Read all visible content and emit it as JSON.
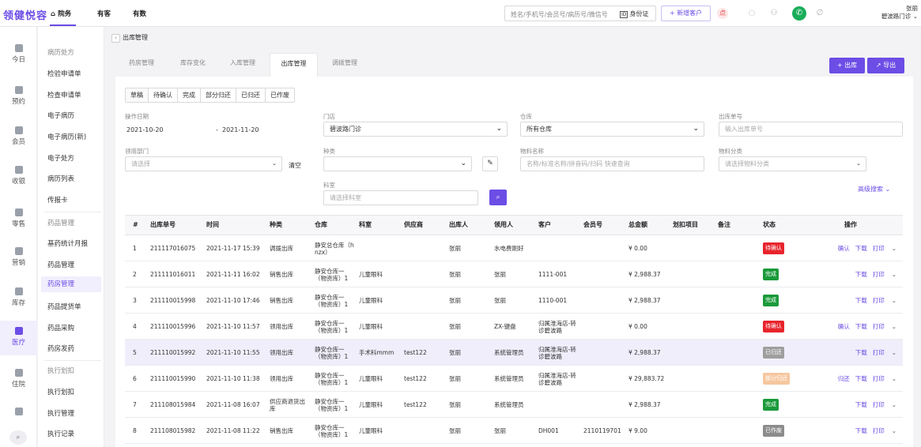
{
  "app": {
    "logo": "领健悦容",
    "nav": [
      "院务",
      "有客",
      "有数"
    ],
    "search_placeholder": "姓名/手机号/会员号/病历号/微信号",
    "idcard_icon": "id-card-icon",
    "idcard_label": "身份证",
    "new_customer": "+ 新增客户",
    "notice_badge": "点",
    "user_name": "张丽",
    "user_store": "碧波路门诊"
  },
  "left_nav": [
    "今日",
    "预约",
    "会员",
    "收银",
    "零售",
    "营销",
    "库存",
    "医疗",
    "住院",
    ""
  ],
  "sub_nav": {
    "groups": [
      {
        "title": "病历处方",
        "items": [
          "检验申请单",
          "检查申请单",
          "电子病历",
          "电子病历(新)",
          "电子处方",
          "病历列表",
          "传报卡"
        ]
      },
      {
        "title": "药品管理",
        "items": [
          "基药统计月报",
          "药品管理",
          "药房管理",
          "药品提货单",
          "药品采购",
          "药房发药"
        ]
      },
      {
        "title": "执行划扣",
        "items": [
          "执行划扣",
          "执行管理",
          "执行记录"
        ]
      }
    ],
    "active": "药房管理"
  },
  "breadcrumb": "出库管理",
  "tabs": [
    "药房管理",
    "库存变化",
    "入库管理",
    "出库管理",
    "调拨管理"
  ],
  "active_tab": "出库管理",
  "actions": {
    "out": "+ 出库",
    "export": "↗ 导出"
  },
  "status_filters": [
    "草稿",
    "待确认",
    "完成",
    "部分归还",
    "已归还",
    "已作废"
  ],
  "filters": {
    "op_date_label": "操作日期",
    "date_start": "2021-10-20",
    "date_sep": "-",
    "date_end": "2021-11-20",
    "store_label": "门店",
    "store_value": "碧波路门诊",
    "warehouse_label": "仓库",
    "warehouse_value": "所有仓库",
    "out_no_label": "出库单号",
    "out_no_placeholder": "输入出库单号",
    "dept_label": "领用部门",
    "dept_placeholder": "请选择",
    "clear": "清空",
    "kind_label": "种类",
    "kind_value": "",
    "material_label": "物料名称",
    "material_placeholder": "名称/标准名称/拼音码/扫码 快速查询",
    "category_label": "物料分类",
    "category_placeholder": "请选择物料分类",
    "room_label": "科室",
    "room_placeholder": "请选择科室",
    "advanced": "高级搜索"
  },
  "table": {
    "headers": [
      "#",
      "出库单号",
      "时间",
      "种类",
      "仓库",
      "科室",
      "供应商",
      "出库人",
      "领用人",
      "客户",
      "会员号",
      "总金额",
      "划扣项目",
      "备注",
      "状态",
      "操作"
    ],
    "rows": [
      {
        "no": "1",
        "id": "211117016075",
        "time": "2021-11-17 15:39",
        "kind": "调拨出库",
        "wh": "静安总仓库（hnzx）",
        "room": "",
        "supplier": "",
        "outer": "张丽",
        "taker": "水电费刚好",
        "customer": "",
        "member": "",
        "amount": "¥ 0.00",
        "deduct": "",
        "note": "",
        "status": "待确认",
        "status_color": "#e8242c",
        "ops": [
          "确认",
          "下载",
          "打印"
        ],
        "ops_dim": false
      },
      {
        "no": "2",
        "id": "211111016011",
        "time": "2021-11-11 16:02",
        "kind": "销售出库",
        "wh": "静安仓库一（物资库）1",
        "room": "儿童眼科",
        "supplier": "",
        "outer": "张丽",
        "taker": "张丽",
        "customer": "1111-001",
        "member": "",
        "amount": "¥ 2,988.37",
        "deduct": "",
        "note": "",
        "status": "完成",
        "status_color": "#1a9a3a",
        "ops": [
          "下载",
          "打印"
        ],
        "ops_dim": false
      },
      {
        "no": "3",
        "id": "211110015998",
        "time": "2021-11-10 17:46",
        "kind": "销售出库",
        "wh": "静安仓库一（物资库）1",
        "room": "儿童眼科",
        "supplier": "",
        "outer": "张丽",
        "taker": "张丽",
        "customer": "1110-001",
        "member": "",
        "amount": "¥ 2,988.37",
        "deduct": "",
        "note": "",
        "status": "完成",
        "status_color": "#1a9a3a",
        "ops": [
          "下载",
          "打印"
        ],
        "ops_dim": false
      },
      {
        "no": "4",
        "id": "211110015996",
        "time": "2021-11-10 11:57",
        "kind": "领用出库",
        "wh": "静安仓库一（物资库）1",
        "room": "儿童眼科",
        "supplier": "",
        "outer": "张丽",
        "taker": "ZX-键盘",
        "customer": "归属淮海店-转诊碧波路",
        "member": "",
        "amount": "¥ 0.00",
        "deduct": "",
        "note": "",
        "status": "待确认",
        "status_color": "#e8242c",
        "ops": [
          "确认",
          "下载",
          "打印"
        ],
        "ops_dim": false
      },
      {
        "no": "5",
        "id": "211110015992",
        "time": "2021-11-10 11:55",
        "kind": "领用出库",
        "wh": "静安仓库一（物资库）1",
        "room": "手术科mmm",
        "supplier": "test122",
        "outer": "张丽",
        "taker": "系统管理员",
        "customer": "归属淮海店-转诊碧波路",
        "member": "",
        "amount": "¥ 2,988.37",
        "deduct": "",
        "note": "",
        "status": "已归还",
        "status_color": "#9e9e9e",
        "ops": [
          "下载",
          "打印"
        ],
        "ops_dim": false
      },
      {
        "no": "6",
        "id": "211110015990",
        "time": "2021-11-10 11:38",
        "kind": "领用出库",
        "wh": "静安仓库一（物资库）1",
        "room": "儿童眼科",
        "supplier": "test122",
        "outer": "张丽",
        "taker": "系统管理员",
        "customer": "归属淮海店-转诊碧波路",
        "member": "",
        "amount": "¥ 29,883.72",
        "deduct": "",
        "note": "",
        "status": "部分归还",
        "status_color": "#f6c7a0",
        "ops": [
          "归还",
          "下载",
          "打印"
        ],
        "ops_dim": false
      },
      {
        "no": "7",
        "id": "211108015984",
        "time": "2021-11-08 16:07",
        "kind": "供应商退货出库",
        "wh": "静安仓库一（物资库）1",
        "room": "儿童眼科",
        "supplier": "test122",
        "outer": "张丽",
        "taker": "系统管理员",
        "customer": "",
        "member": "",
        "amount": "¥ 2,988.37",
        "deduct": "",
        "note": "",
        "status": "完成",
        "status_color": "#1a9a3a",
        "ops": [
          "下载",
          "打印"
        ],
        "ops_dim": false
      },
      {
        "no": "8",
        "id": "211108015982",
        "time": "2021-11-08 11:22",
        "kind": "销售出库",
        "wh": "静安仓库一（物资库）1",
        "room": "儿童眼科",
        "supplier": "",
        "outer": "张丽",
        "taker": "张丽",
        "customer": "DH001",
        "member": "2110119701",
        "amount": "¥ 9.00",
        "deduct": "",
        "note": "",
        "status": "已作废",
        "status_color": "#8c8c8c",
        "ops": [
          "下载",
          "打印"
        ],
        "ops_dim": false
      }
    ]
  }
}
